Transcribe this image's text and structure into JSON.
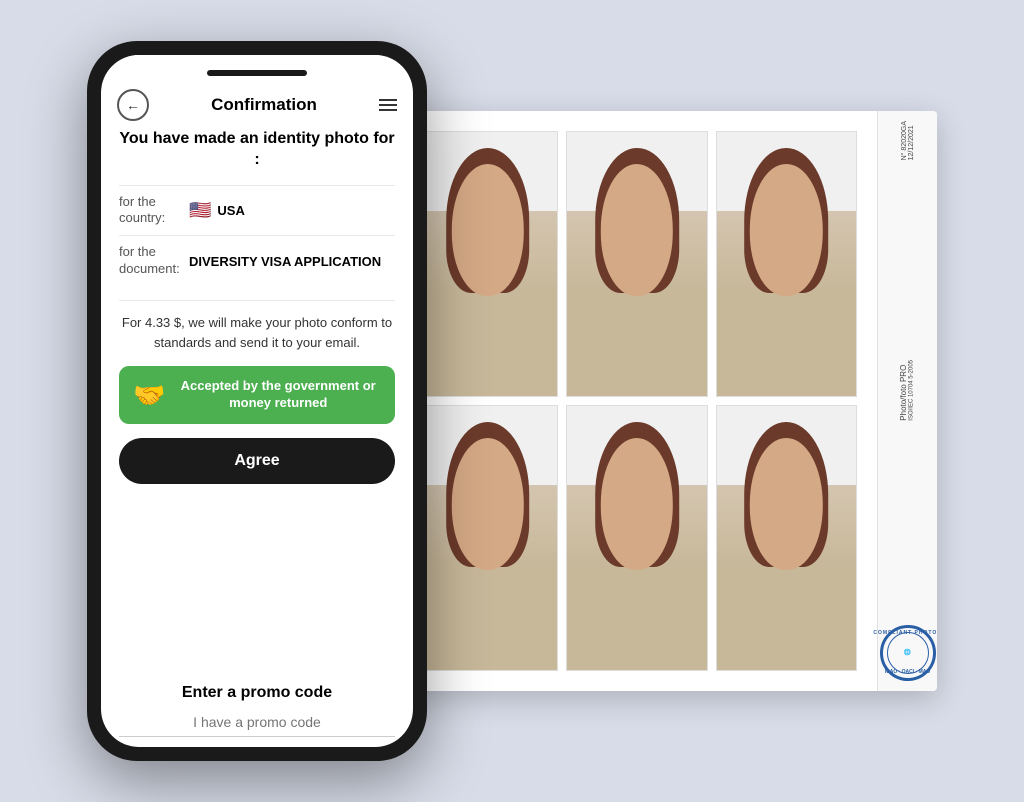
{
  "background_color": "#d8dce8",
  "phone": {
    "nav": {
      "back_icon": "←",
      "title": "Confirmation",
      "menu_icon": "≡"
    },
    "header_title": "You have made an identity photo for :",
    "info_rows": [
      {
        "label": "for the country:",
        "flag": "🇺🇸",
        "value": "USA"
      },
      {
        "label": "for the document:",
        "value": "DIVERSITY VISA APPLICATION"
      }
    ],
    "pricing_text": "For 4.33 $, we will make your photo conform to standards and send it to your email.",
    "guarantee": {
      "icon": "🤝",
      "text": "Accepted by the government or money returned"
    },
    "agree_button": "Agree",
    "promo": {
      "title": "Enter a promo code",
      "placeholder": "I have a promo code"
    }
  },
  "photo_sheet": {
    "serial": "N° 82020GA",
    "date": "12/12/2021",
    "brand": "Photo/foto PRO",
    "iso": "ISO/IEC 10704 5-2005",
    "stamp_text": "COMPLIANT PHOTOS",
    "stamp_center": "ICAO\nOACI\nMAO"
  }
}
